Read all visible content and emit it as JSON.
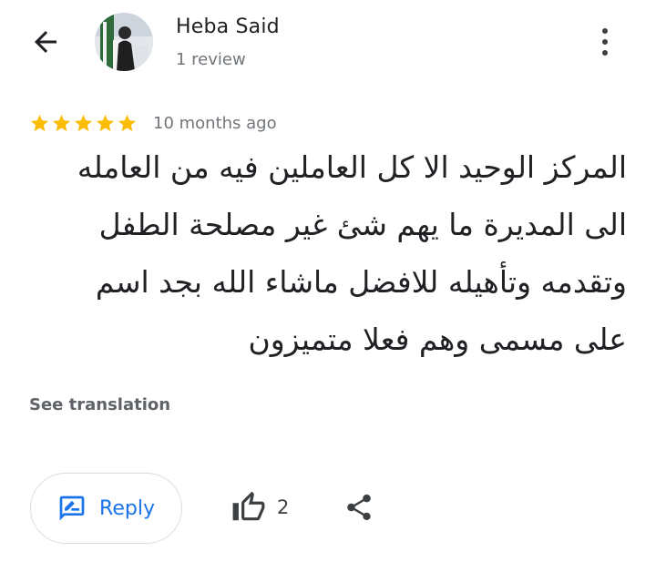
{
  "header": {
    "back_icon": "arrow-left-icon",
    "more_icon": "more-vert-icon"
  },
  "reviewer": {
    "name": "Heba Said",
    "review_count": "1 review",
    "avatar": "profile-photo"
  },
  "review": {
    "rating": 5,
    "max_rating": 5,
    "star_color": "#fbbc04",
    "time_ago": "10 months ago",
    "text": "المركز الوحيد الا كل العاملين فيه من العامله الى المديرة ما يهم شئ غير مصلحة الطفل وتقدمه وتأهيله للافضل ماشاء الله بجد اسم على مسمى وهم فعلا متميزون",
    "see_translation": "See translation"
  },
  "actions": {
    "reply_label": "Reply",
    "reply_icon": "rate-review-icon",
    "like_icon": "thumb-up-icon",
    "like_count": "2",
    "share_icon": "share-icon",
    "accent_color": "#1a73e8"
  }
}
